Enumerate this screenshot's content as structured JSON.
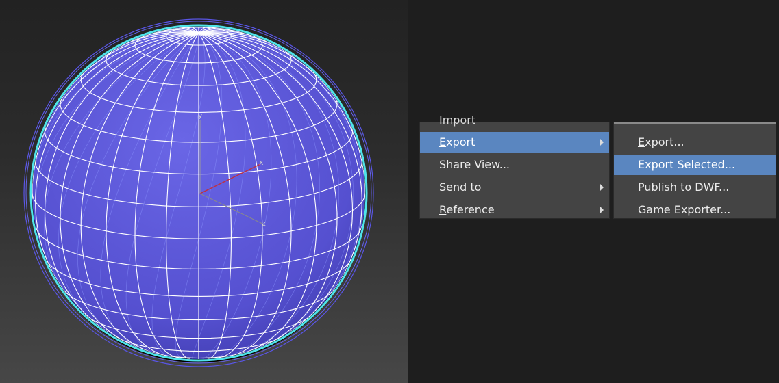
{
  "viewport": {
    "axes": {
      "x": "x",
      "y": "y",
      "z": "z"
    },
    "colors": {
      "sphere_fill": "#5752d2",
      "wire": "#ffffff",
      "outline_cyan": "#4fe3e9",
      "outline_blue": "#5a56e8"
    }
  },
  "file_menu": {
    "cut_off_item": "Import",
    "items": [
      {
        "label": "Export",
        "mnemonic": "E",
        "rest": "xport",
        "has_submenu": true,
        "highlighted": true
      },
      {
        "label": "Share View...",
        "mnemonic": "",
        "rest": "Share View...",
        "has_submenu": false,
        "highlighted": false
      },
      {
        "label": "Send to",
        "mnemonic": "S",
        "rest": "end to",
        "has_submenu": true,
        "highlighted": false
      },
      {
        "label": "Reference",
        "mnemonic": "R",
        "rest": "eference",
        "has_submenu": true,
        "highlighted": false
      }
    ]
  },
  "export_submenu": {
    "items": [
      {
        "label": "Export...",
        "mnemonic": "E",
        "rest": "xport...",
        "highlighted": false
      },
      {
        "label": "Export Selected...",
        "mnemonic": "",
        "rest": "Export Selected...",
        "highlighted": true
      },
      {
        "label": "Publish to DWF...",
        "mnemonic": "",
        "rest": "Publish to DWF...",
        "highlighted": false
      },
      {
        "label": "Game Exporter...",
        "mnemonic": "",
        "rest": "Game Exporter...",
        "highlighted": false
      }
    ]
  },
  "colors": {
    "menu_bg": "#444444",
    "highlight": "#5a86c0",
    "text": "#ececec"
  }
}
